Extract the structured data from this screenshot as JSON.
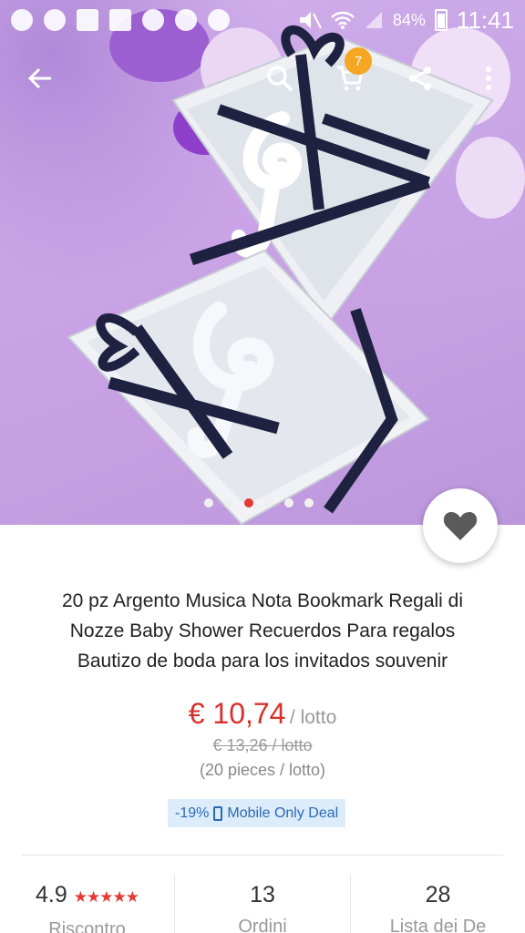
{
  "status_bar": {
    "battery": "84%",
    "time": "11:41"
  },
  "toolbar": {
    "back_icon": "arrow-left-icon",
    "search_icon": "search-icon",
    "cart_icon": "cart-icon",
    "cart_count": "7",
    "share_icon": "share-icon",
    "more_icon": "more-vert-icon"
  },
  "gallery": {
    "dot_count": 6,
    "active_index": 2
  },
  "product": {
    "title_line1": "20 pz Argento Musica Nota Bookmark Regali di",
    "title_line2": "Nozze Baby Shower Recuerdos Para regalos",
    "title_line3": "Bautizo de boda para los invitados souvenir",
    "price": "€ 10,74",
    "unit": "/ lotto",
    "old_price": "€ 13,26 / lotto",
    "pieces": "(20 pieces / lotto)",
    "discount": "-19%",
    "deal_label": "Mobile Only Deal"
  },
  "stats": {
    "rating_value": "4.9",
    "rating_stars": "★★★★★",
    "rating_label": "Riscontro",
    "orders_value": "13",
    "orders_label": "Ordini",
    "wishlist_value": "28",
    "wishlist_label": "Lista dei De"
  },
  "colors": {
    "accent": "#d9302b",
    "badge": "#f5a623",
    "deal_bg": "#dcecfb",
    "deal_text": "#2a6ab4"
  }
}
